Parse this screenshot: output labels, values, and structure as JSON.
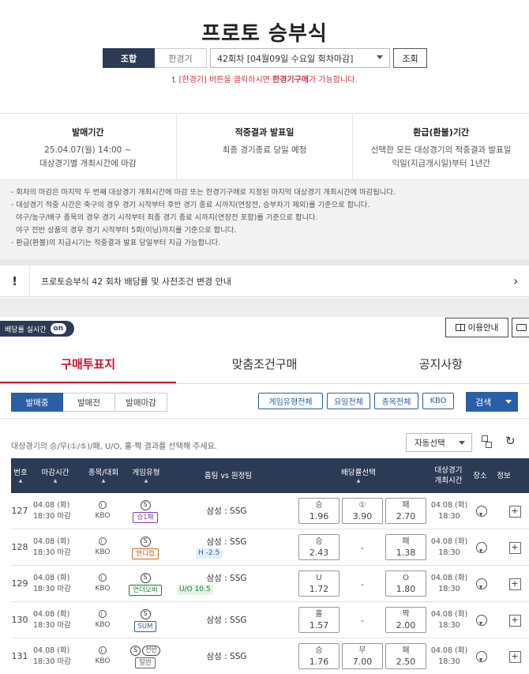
{
  "header": {
    "title": "프로토 승부식",
    "seg_combo": "조합",
    "seg_single": "한경기",
    "round_select": "42회차 [04월09일 수요일 회차마감]",
    "query_button": "조회",
    "notice_prefix": "⮤ [한경기] 버튼을 클릭하시면 ",
    "notice_bold": "한경기구매",
    "notice_suffix": "가 가능합니다."
  },
  "info": [
    {
      "heading": "발매기간",
      "line1": "25.04.07(월) 14:00 ~",
      "line2": "대상경기별 개최시간에 마감"
    },
    {
      "heading": "적중결과 발표일",
      "line1": "최종 경기종료 당일 예정",
      "line2": ""
    },
    {
      "heading": "환급(환불)기간",
      "line1": "선택한 모든 대상경기의 적중결과 발표일",
      "line2": "익일(지급개시일)부터 1년간"
    }
  ],
  "notes": [
    "- 회차의 마감은 마지막 두 번째 대상경기 개최시간에 마감 또는 한경기구매로 지정된 마지막 대상경기 개최시간에 마감됩니다.",
    "- 대상경기 적중 시간은 축구의 경우 경기 시작부터 후반 경기 종료 시까지(연장전, 승부차기 제외)를 기준으로 합니다.",
    "  야구/농구/배구 종목의 경우 경기 시작부터 최종 경기 종료 시까지(연장전 포함)를 기준으로 합니다.",
    "  야구 전반 상품의 경우 경기 시작부터 5회(이닝)까지를 기준으로 합니다.",
    "- 환급(환불)의 지급시기는 적중결과 발표 당일부터 지급 가능합니다."
  ],
  "alert": {
    "icon": "!",
    "message": "프로토승부식 42 회차 배당률 및 사전조건 변경 안내",
    "chevron": "›"
  },
  "toolbar": {
    "odds_realtime": "배당률 실시간",
    "odds_toggle": "on",
    "guide_button": "이용안내"
  },
  "tabs": [
    "구매투표지",
    "맞춤조건구매",
    "공지사항"
  ],
  "sale_status": [
    "발매중",
    "발매전",
    "발매마감"
  ],
  "filters": [
    "게임유형전체",
    "요일전체",
    "종목전체",
    "KBO"
  ],
  "search_button": "검색",
  "instruction": "대상경기의 승/무(①/⑤)/패, U/O, 홀·짝 결과를 선택해 주세요.",
  "auto_select": "자동선택",
  "refresh_icon": "↻",
  "table_headers": {
    "no": "번호",
    "deadline": "마감시간",
    "sport": "종목/대회",
    "gametype": "게임유형",
    "teams": "홈팀 vs 원정팀",
    "odds": "배당률선택",
    "gametime_1": "대상경기",
    "gametime_2": "개최시간",
    "place": "장소",
    "info": "정보",
    "sort_arrow": "▲"
  },
  "rows": [
    {
      "no": "127",
      "date": "04.08 (화)",
      "deadline": "18:30 마감",
      "league": "KBO",
      "s_badge": "S",
      "s_pill": "",
      "type": "승1패",
      "teams": "삼성 : SSG",
      "handicap": "",
      "o1_label": "승",
      "o1_value": "1.96",
      "o2_label": "①",
      "o2_value": "3.90",
      "o2_dash": "",
      "o3_label": "패",
      "o3_value": "2.70",
      "game_date": "04.08 (화)",
      "game_time": "18:30"
    },
    {
      "no": "128",
      "date": "04.08 (화)",
      "deadline": "18:30 마감",
      "league": "KBO",
      "s_badge": "S",
      "s_pill": "",
      "type": "핸디캡",
      "teams": "삼성 : SSG",
      "handicap": "H -2.5",
      "o1_label": "승",
      "o1_value": "2.43",
      "o2_label": "",
      "o2_value": "",
      "o2_dash": "-",
      "o3_label": "패",
      "o3_value": "1.38",
      "game_date": "04.08 (화)",
      "game_time": "18:30"
    },
    {
      "no": "129",
      "date": "04.08 (화)",
      "deadline": "18:30 마감",
      "league": "KBO",
      "s_badge": "S",
      "s_pill": "",
      "type": "언더오버",
      "teams": "삼성 : SSG",
      "handicap": "U/O 10.5",
      "o1_label": "U",
      "o1_value": "1.72",
      "o2_label": "",
      "o2_value": "",
      "o2_dash": "-",
      "o3_label": "O",
      "o3_value": "1.80",
      "game_date": "04.08 (화)",
      "game_time": "18:30"
    },
    {
      "no": "130",
      "date": "04.08 (화)",
      "deadline": "18:30 마감",
      "league": "KBO",
      "s_badge": "S",
      "s_pill": "",
      "type": "SUM",
      "teams": "삼성 : SSG",
      "handicap": "",
      "o1_label": "홀",
      "o1_value": "1.57",
      "o2_label": "",
      "o2_value": "",
      "o2_dash": "-",
      "o3_label": "짝",
      "o3_value": "2.00",
      "game_date": "04.08 (화)",
      "game_time": "18:30"
    },
    {
      "no": "131",
      "date": "04.08 (화)",
      "deadline": "18:30 마감",
      "league": "KBO",
      "s_badge": "S",
      "s_pill": "전반",
      "type": "일반",
      "teams": "삼성 : SSG",
      "handicap": "",
      "o1_label": "승",
      "o1_value": "1.76",
      "o2_label": "무",
      "o2_value": "7.00",
      "o2_dash": "",
      "o3_label": "패",
      "o3_value": "2.50",
      "game_date": "04.08 (화)",
      "game_time": "18:30"
    }
  ],
  "colors": {
    "navy": "#2b3a55",
    "accent_red": "#c8102e",
    "blue": "#2b5ea8"
  }
}
